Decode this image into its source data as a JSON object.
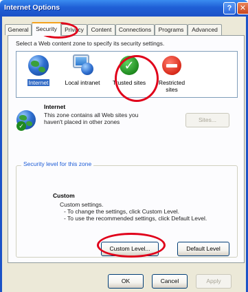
{
  "window": {
    "title": "Internet Options"
  },
  "tabs": [
    "General",
    "Security",
    "Privacy",
    "Content",
    "Connections",
    "Programs",
    "Advanced"
  ],
  "active_tab": "Security",
  "security": {
    "instruction": "Select a Web content zone to specify its security settings.",
    "zones": [
      {
        "label": "Internet",
        "icon": "globe-icon"
      },
      {
        "label": "Local intranet",
        "icon": "local-intranet-icon"
      },
      {
        "label": "Trusted sites",
        "icon": "trusted-check-icon"
      },
      {
        "label": "Restricted sites",
        "icon": "restricted-stop-icon"
      }
    ],
    "selected_zone": "Internet",
    "zone_info": {
      "name": "Internet",
      "description": "This zone contains all Web sites you haven't placed in other zones"
    },
    "sites_button": "Sites...",
    "level_group_title": "Security level for this zone",
    "level": {
      "name": "Custom",
      "line1": "Custom settings.",
      "line2": "- To change the settings, click Custom Level.",
      "line3": "- To use the recommended settings, click Default Level."
    },
    "custom_level_button": "Custom Level...",
    "default_level_button": "Default Level"
  },
  "footer": {
    "ok": "OK",
    "cancel": "Cancel",
    "apply": "Apply"
  },
  "colors": {
    "annotation": "#e0001a",
    "titlebar": "#1f5fd6",
    "selection": "#316ac5"
  }
}
